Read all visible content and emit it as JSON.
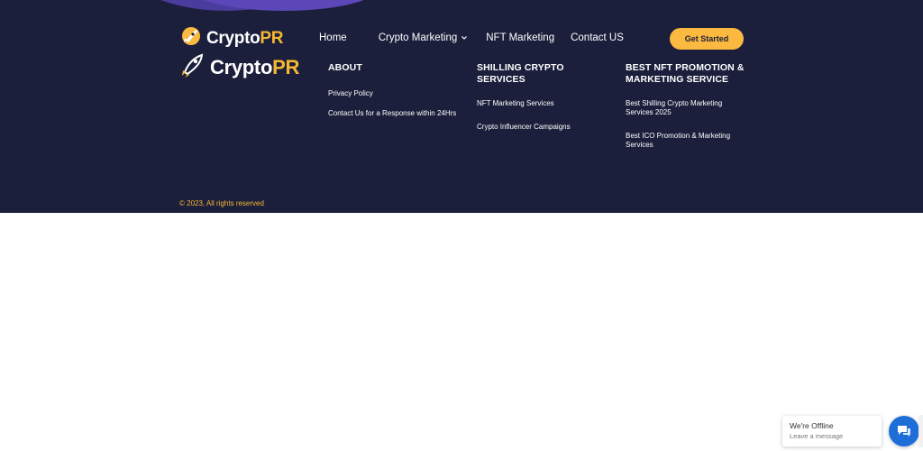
{
  "brand": {
    "name_prefix": "Crypto",
    "name_suffix": "PR",
    "accent": "#fbb93f",
    "background": "#1b1f3b",
    "icon": "rocket-icon"
  },
  "nav": {
    "items": [
      {
        "label": "Home"
      },
      {
        "label": "Crypto Marketing",
        "has_dropdown": true
      },
      {
        "label": "NFT Marketing"
      },
      {
        "label": "Contact US"
      }
    ],
    "cta_label": "Get Started"
  },
  "footer": {
    "columns": [
      {
        "heading": "ABOUT",
        "links": [
          "Privacy Policy",
          "Contact Us for a Response within 24Hrs"
        ]
      },
      {
        "heading": "SHILLING CRYPTO SERVICES",
        "links": [
          "NFT Marketing Services",
          "Crypto Influencer Campaigns"
        ]
      },
      {
        "heading": "BEST NFT PROMOTION & MARKETING SERVICE",
        "links": [
          "Best Shilling Crypto Marketing Services 2025",
          "Best ICO Promotion & Marketing Services"
        ]
      }
    ],
    "copyright": "© 2023, All rights reserved"
  },
  "chat": {
    "status": "We're Offline",
    "subtitle": "Leave a message",
    "icon": "chat-bubble-icon"
  }
}
